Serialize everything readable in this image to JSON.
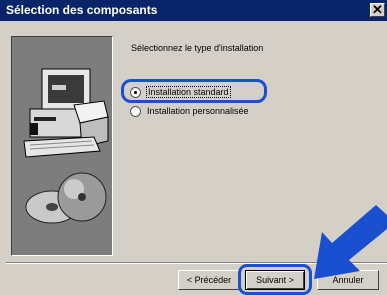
{
  "window": {
    "title": "Sélection des composants",
    "close_glyph": "✕"
  },
  "content": {
    "heading": "Sélectionnez le type d'installation",
    "options": [
      {
        "label": "Installation standard",
        "selected": true
      },
      {
        "label": "Installation personnalisée",
        "selected": false
      }
    ]
  },
  "buttons": {
    "back": "< Précéder",
    "next": "Suivant >",
    "cancel": "Annuler"
  },
  "colors": {
    "titlebar": "#0a246a",
    "highlight": "#1a4fd0",
    "dialog": "#d4d0c8"
  },
  "icons": [
    "close-icon",
    "computer-illustration",
    "pointer-arrow-icon"
  ]
}
